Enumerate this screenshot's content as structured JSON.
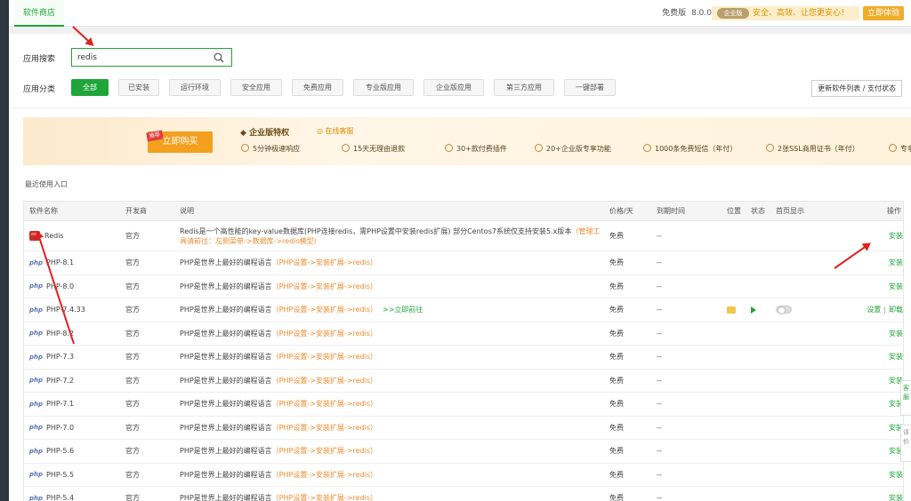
{
  "top": {
    "tab_label": "软件商店",
    "version_label": "免费版",
    "version_number": "8.0.0",
    "enterprise_badge": "企业版",
    "enterprise_slogan": "安全、高效、让您更安心！",
    "trial_button": "立即体验"
  },
  "search": {
    "label": "应用搜索",
    "value": "redis"
  },
  "categories": {
    "label": "应用分类",
    "items": [
      "全部",
      "已安装",
      "运行环境",
      "安全应用",
      "免费应用",
      "专业版应用",
      "企业版应用",
      "第三方应用",
      "一键部署"
    ],
    "active_index": 0,
    "update_button": "更新软件列表 / 支付状态"
  },
  "banner": {
    "buy_tag": "推荐",
    "buy_button": "立即购买",
    "title": "企业版特权",
    "service_link": "在线客服",
    "perks": [
      "5分钟极速响应",
      "15天无理由退款",
      "30+款付费插件",
      "20+企业版专享功能",
      "1000条免费短信（年付）",
      "2张SSL商用证书（年付）",
      "专享企业"
    ]
  },
  "recent_label": "最近使用入口",
  "table": {
    "headers": {
      "name": "软件名称",
      "developer": "开发商",
      "description": "说明",
      "price": "价格/天",
      "expire": "到期时间",
      "position": "位置",
      "status": "状态",
      "homepage": "首页显示",
      "ops": "操作"
    },
    "redis": {
      "name": "Redis",
      "developer": "官方",
      "description": "Redis是一个高性能的key-value数据库(PHP连接redis，需PHP设置中安装redis扩展) 部分Centos7系统仅支持安装5.x版本",
      "manage_hint": "（管理工具请前往：左侧菜单->数据库->redis模型）",
      "price": "免费",
      "expire": "--",
      "action": "安装"
    },
    "php_desc": "PHP是世界上最好的编程语言",
    "php_link": "（PHP设置->安装扩展->redis）",
    "goto_text": ">>立即前往",
    "php_rows": [
      {
        "name": "PHP-8.1",
        "developer": "官方",
        "price": "免费",
        "expire": "--",
        "action": "安装",
        "installed": false
      },
      {
        "name": "PHP-8.0",
        "developer": "官方",
        "price": "免费",
        "expire": "--",
        "action": "安装",
        "installed": false
      },
      {
        "name": "PHP-7.4.33",
        "developer": "官方",
        "price": "免费",
        "expire": "--",
        "action": "设置",
        "action2": "卸载",
        "installed": true
      },
      {
        "name": "PHP-8.2",
        "developer": "官方",
        "price": "免费",
        "expire": "--",
        "action": "安装",
        "installed": false
      },
      {
        "name": "PHP-7.3",
        "developer": "官方",
        "price": "免费",
        "expire": "--",
        "action": "安装",
        "installed": false
      },
      {
        "name": "PHP-7.2",
        "developer": "官方",
        "price": "免费",
        "expire": "--",
        "action": "安装",
        "installed": false
      },
      {
        "name": "PHP-7.1",
        "developer": "官方",
        "price": "免费",
        "expire": "--",
        "action": "安装",
        "installed": false
      },
      {
        "name": "PHP-7.0",
        "developer": "官方",
        "price": "免费",
        "expire": "--",
        "action": "安装",
        "installed": false
      },
      {
        "name": "PHP-5.6",
        "developer": "官方",
        "price": "免费",
        "expire": "--",
        "action": "安装",
        "installed": false
      },
      {
        "name": "PHP-5.5",
        "developer": "官方",
        "price": "免费",
        "expire": "--",
        "action": "安装",
        "installed": false
      },
      {
        "name": "PHP-5.4",
        "developer": "官方",
        "price": "免费",
        "expire": "--",
        "action": "安装",
        "installed": false
      }
    ],
    "php_icon_text": "php"
  },
  "float_tabs": [
    "客服",
    "评价"
  ],
  "colors": {
    "accent": "#20a53a",
    "link": "#f08a2c",
    "annotation": "#e02020"
  }
}
